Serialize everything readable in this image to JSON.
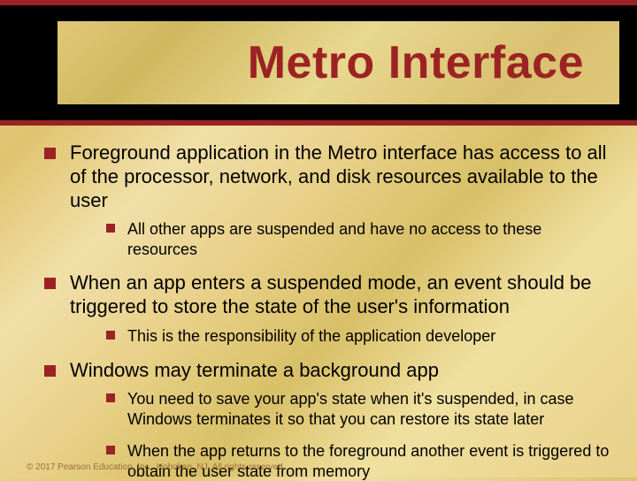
{
  "title": "Metro Interface",
  "bullets": [
    {
      "text": "Foreground application in the Metro interface has access to all of the processor, network, and disk resources available to the user",
      "sub": [
        "All other apps are suspended and have no access to these resources"
      ]
    },
    {
      "text": "When an app enters a suspended mode, an event should be triggered to store the state of the user's information",
      "sub": [
        "This is the responsibility of the application developer"
      ]
    },
    {
      "text": "Windows may terminate a background app",
      "sub": [
        "You need to save your app's state when it's suspended, in case Windows terminates it so that you can restore its state later",
        "When the app returns to the foreground another event is triggered to obtain the user state from memory"
      ]
    }
  ],
  "footer": "© 2017 Pearson Education, Inc., Hoboken, NJ. All rights reserved."
}
